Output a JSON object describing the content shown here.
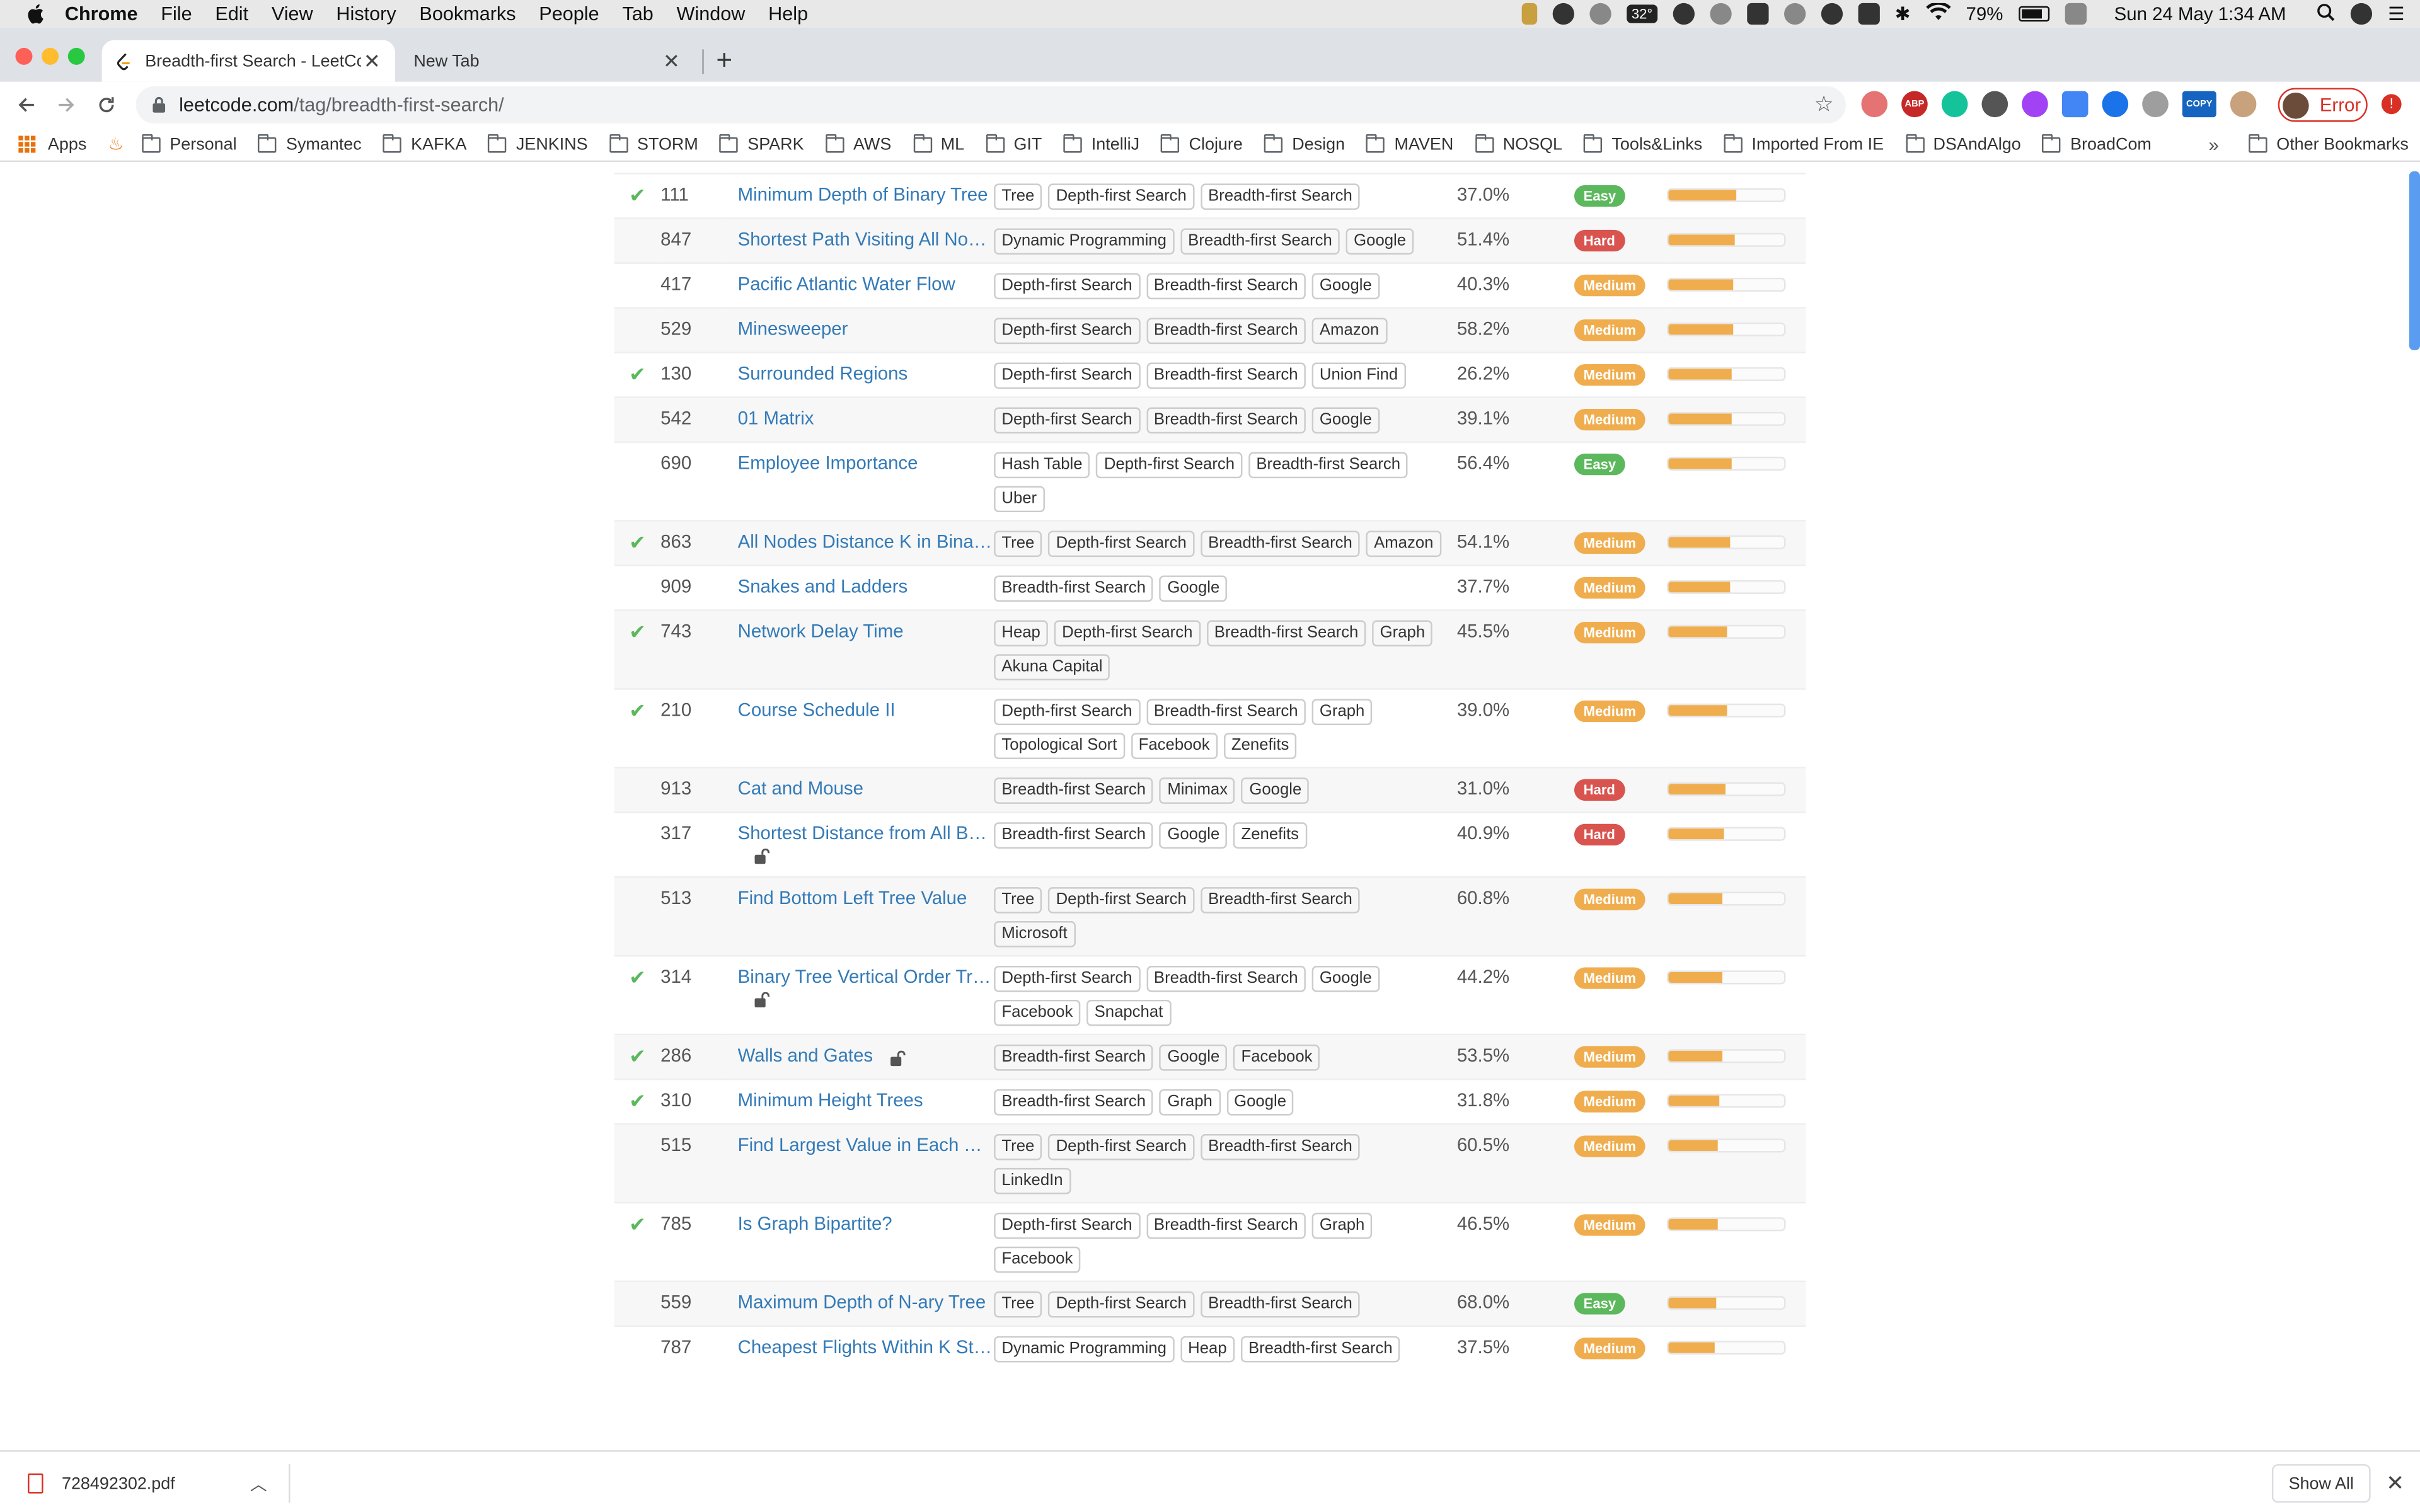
{
  "menubar": {
    "app": "Chrome",
    "items": [
      "File",
      "Edit",
      "View",
      "History",
      "Bookmarks",
      "People",
      "Tab",
      "Window",
      "Help"
    ],
    "temperature": "32°",
    "battery": "79%",
    "datetime": "Sun 24 May  1:34 AM"
  },
  "tabs": [
    {
      "title": "Breadth-first Search - LeetCode"
    },
    {
      "title": "New Tab"
    }
  ],
  "toolbar": {
    "url_host": "leetcode.com",
    "url_path": "/tag/breadth-first-search/",
    "profile_label": "Error",
    "ext_copy_label": "COPY",
    "ext_abp_label": "ABP"
  },
  "bookmarks": {
    "apps_label": "Apps",
    "items": [
      "Personal",
      "Symantec",
      "KAFKA",
      "JENKINS",
      "STORM",
      "SPARK",
      "AWS",
      "ML",
      "GIT",
      "IntelliJ",
      "Clojure",
      "Design",
      "MAVEN",
      "NOSQL",
      "Tools&Links",
      "Imported From IE",
      "DSAndAlgo",
      "BroadCom"
    ],
    "overflow": "»",
    "other": "Other Bookmarks"
  },
  "colors": {
    "easy": "#5cb85c",
    "medium": "#f0ad4e",
    "hard": "#d9534f",
    "link": "#337ab7"
  },
  "questions": [
    {
      "solved": true,
      "id": "111",
      "title": "Minimum Depth of Binary Tree",
      "locked": false,
      "tags": [
        "Tree",
        "Depth-first Search",
        "Breadth-first Search"
      ],
      "acceptance": "37.0%",
      "difficulty": "Easy",
      "frequency": 0.58
    },
    {
      "solved": false,
      "id": "847",
      "title": "Shortest Path Visiting All Nodes",
      "locked": false,
      "tags": [
        "Dynamic Programming",
        "Breadth-first Search",
        "Google"
      ],
      "acceptance": "51.4%",
      "difficulty": "Hard",
      "frequency": 0.57
    },
    {
      "solved": false,
      "id": "417",
      "title": "Pacific Atlantic Water Flow",
      "locked": false,
      "tags": [
        "Depth-first Search",
        "Breadth-first Search",
        "Google"
      ],
      "acceptance": "40.3%",
      "difficulty": "Medium",
      "frequency": 0.56
    },
    {
      "solved": false,
      "id": "529",
      "title": "Minesweeper",
      "locked": false,
      "tags": [
        "Depth-first Search",
        "Breadth-first Search",
        "Amazon"
      ],
      "acceptance": "58.2%",
      "difficulty": "Medium",
      "frequency": 0.56
    },
    {
      "solved": true,
      "id": "130",
      "title": "Surrounded Regions",
      "locked": false,
      "tags": [
        "Depth-first Search",
        "Breadth-first Search",
        "Union Find"
      ],
      "acceptance": "26.2%",
      "difficulty": "Medium",
      "frequency": 0.55
    },
    {
      "solved": false,
      "id": "542",
      "title": "01 Matrix",
      "locked": false,
      "tags": [
        "Depth-first Search",
        "Breadth-first Search",
        "Google"
      ],
      "acceptance": "39.1%",
      "difficulty": "Medium",
      "frequency": 0.54
    },
    {
      "solved": false,
      "id": "690",
      "title": "Employee Importance",
      "locked": false,
      "tags": [
        "Hash Table",
        "Depth-first Search",
        "Breadth-first Search",
        "Uber"
      ],
      "acceptance": "56.4%",
      "difficulty": "Easy",
      "frequency": 0.54
    },
    {
      "solved": true,
      "id": "863",
      "title": "All Nodes Distance K in Binary Tree",
      "locked": false,
      "tags": [
        "Tree",
        "Depth-first Search",
        "Breadth-first Search",
        "Amazon"
      ],
      "acceptance": "54.1%",
      "difficulty": "Medium",
      "frequency": 0.53
    },
    {
      "solved": false,
      "id": "909",
      "title": "Snakes and Ladders",
      "locked": false,
      "tags": [
        "Breadth-first Search",
        "Google"
      ],
      "acceptance": "37.7%",
      "difficulty": "Medium",
      "frequency": 0.53
    },
    {
      "solved": true,
      "id": "743",
      "title": "Network Delay Time",
      "locked": false,
      "tags": [
        "Heap",
        "Depth-first Search",
        "Breadth-first Search",
        "Graph",
        "Akuna Capital"
      ],
      "acceptance": "45.5%",
      "difficulty": "Medium",
      "frequency": 0.5
    },
    {
      "solved": true,
      "id": "210",
      "title": "Course Schedule II",
      "locked": false,
      "tags": [
        "Depth-first Search",
        "Breadth-first Search",
        "Graph",
        "Topological Sort",
        "Facebook",
        "Zenefits"
      ],
      "acceptance": "39.0%",
      "difficulty": "Medium",
      "frequency": 0.5
    },
    {
      "solved": false,
      "id": "913",
      "title": "Cat and Mouse",
      "locked": false,
      "tags": [
        "Breadth-first Search",
        "Minimax",
        "Google"
      ],
      "acceptance": "31.0%",
      "difficulty": "Hard",
      "frequency": 0.49
    },
    {
      "solved": false,
      "id": "317",
      "title": "Shortest Distance from All Buildings",
      "locked": true,
      "tags": [
        "Breadth-first Search",
        "Google",
        "Zenefits"
      ],
      "acceptance": "40.9%",
      "difficulty": "Hard",
      "frequency": 0.48
    },
    {
      "solved": false,
      "id": "513",
      "title": "Find Bottom Left Tree Value",
      "locked": false,
      "tags": [
        "Tree",
        "Depth-first Search",
        "Breadth-first Search",
        "Microsoft"
      ],
      "acceptance": "60.8%",
      "difficulty": "Medium",
      "frequency": 0.47
    },
    {
      "solved": true,
      "id": "314",
      "title": "Binary Tree Vertical Order Traversal",
      "locked": true,
      "tags": [
        "Depth-first Search",
        "Breadth-first Search",
        "Google",
        "Facebook",
        "Snapchat"
      ],
      "acceptance": "44.2%",
      "difficulty": "Medium",
      "frequency": 0.47
    },
    {
      "solved": true,
      "id": "286",
      "title": "Walls and Gates",
      "locked": true,
      "tags": [
        "Breadth-first Search",
        "Google",
        "Facebook"
      ],
      "acceptance": "53.5%",
      "difficulty": "Medium",
      "frequency": 0.46
    },
    {
      "solved": true,
      "id": "310",
      "title": "Minimum Height Trees",
      "locked": false,
      "tags": [
        "Breadth-first Search",
        "Graph",
        "Google"
      ],
      "acceptance": "31.8%",
      "difficulty": "Medium",
      "frequency": 0.44
    },
    {
      "solved": false,
      "id": "515",
      "title": "Find Largest Value in Each Tree Row",
      "locked": false,
      "tags": [
        "Tree",
        "Depth-first Search",
        "Breadth-first Search",
        "LinkedIn"
      ],
      "acceptance": "60.5%",
      "difficulty": "Medium",
      "frequency": 0.43
    },
    {
      "solved": true,
      "id": "785",
      "title": "Is Graph Bipartite?",
      "locked": false,
      "tags": [
        "Depth-first Search",
        "Breadth-first Search",
        "Graph",
        "Facebook"
      ],
      "acceptance": "46.5%",
      "difficulty": "Medium",
      "frequency": 0.42
    },
    {
      "solved": false,
      "id": "559",
      "title": "Maximum Depth of N-ary Tree",
      "locked": false,
      "tags": [
        "Tree",
        "Depth-first Search",
        "Breadth-first Search"
      ],
      "acceptance": "68.0%",
      "difficulty": "Easy",
      "frequency": 0.41
    },
    {
      "solved": false,
      "id": "787",
      "title": "Cheapest Flights Within K Stops",
      "locked": false,
      "tags": [
        "Dynamic Programming",
        "Heap",
        "Breadth-first Search"
      ],
      "acceptance": "37.5%",
      "difficulty": "Medium",
      "frequency": 0.4
    }
  ],
  "download": {
    "filename": "728492302.pdf",
    "show_all": "Show All"
  }
}
